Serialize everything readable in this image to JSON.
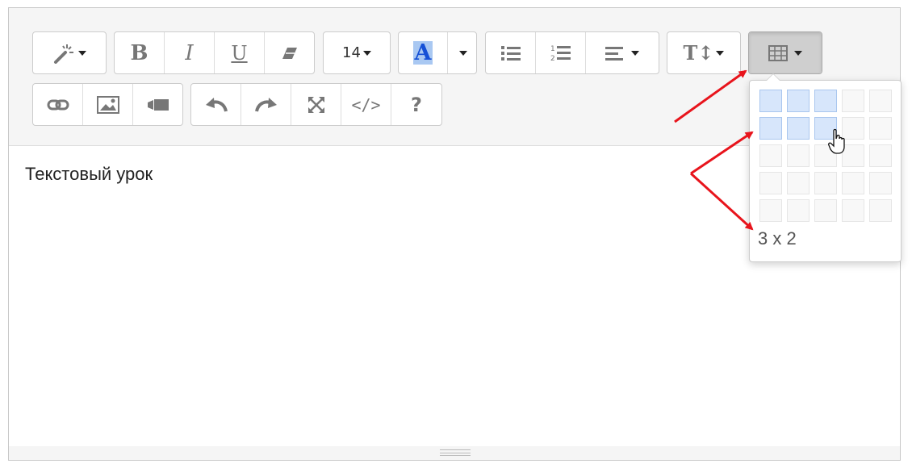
{
  "toolbar": {
    "font_size_value": "14",
    "color_letter": "A",
    "color_highlight": "#a9c8f2",
    "color_text": "#1550d6",
    "active_button_color": "#cfcfcf",
    "icons": [
      "magic-wand-icon",
      "bold-icon",
      "italic-icon",
      "underline-icon",
      "eraser-icon",
      "font-size-dropdown",
      "font-color-icon",
      "bullet-list-icon",
      "numbered-list-icon",
      "align-icon",
      "line-height-icon",
      "table-icon",
      "link-icon",
      "image-icon",
      "video-icon",
      "undo-icon",
      "redo-icon",
      "fullscreen-icon",
      "code-view-icon",
      "help-icon"
    ]
  },
  "editor": {
    "content_text": "Текстовый урок"
  },
  "table_picker": {
    "selected_cols": 3,
    "selected_rows": 2,
    "total_cols": 5,
    "total_rows": 5,
    "dimension_label": "3 x 2",
    "selected_cell_color": "#d7e6fb"
  },
  "annotation": {
    "arrow_color": "#e8141c"
  }
}
